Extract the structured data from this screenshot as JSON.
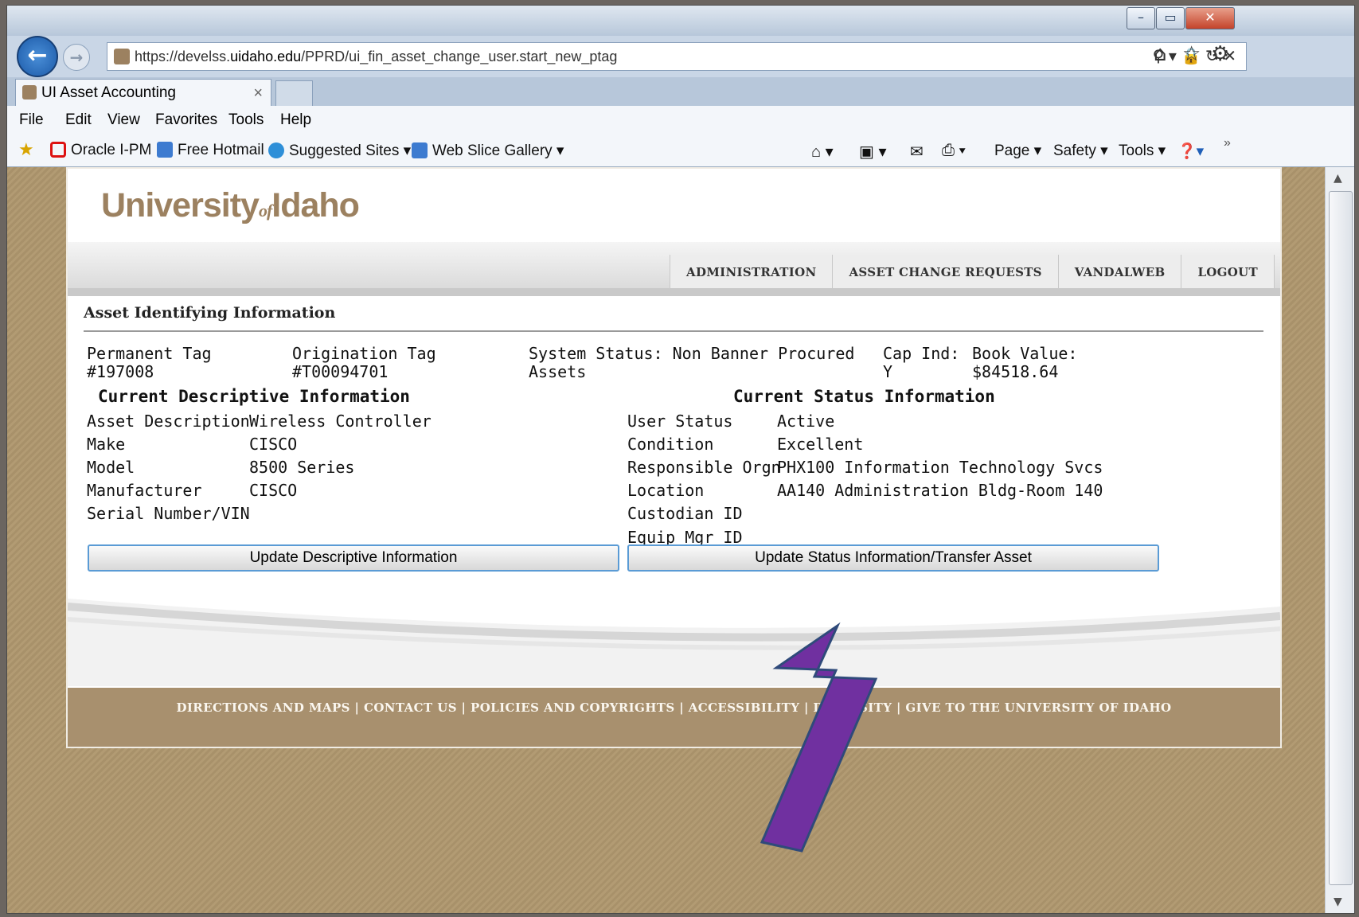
{
  "browser": {
    "url_scheme": "https://",
    "url_host_pre": "develss.",
    "url_host": "uidaho.edu",
    "url_path": "/PPRD/ui_fin_asset_change_user.start_new_ptag",
    "tab_title": "UI Asset Accounting",
    "tab_close": "×",
    "menu": [
      "File",
      "Edit",
      "View",
      "Favorites",
      "Tools",
      "Help"
    ],
    "favorites": [
      "Oracle I-PM",
      "Free Hotmail",
      "Suggested Sites ▾",
      "Web Slice Gallery ▾"
    ],
    "toolbar_right": [
      "Page ▾",
      "Safety ▾",
      "Tools ▾"
    ],
    "window_controls": [
      "–",
      "▭",
      "✕"
    ]
  },
  "site": {
    "logo_pre": "University",
    "logo_of": "of",
    "logo_post": "Idaho",
    "nav": [
      "ADMINISTRATION",
      "ASSET CHANGE REQUESTS",
      "VANDALWEB",
      "LOGOUT"
    ],
    "footer": "DIRECTIONS AND MAPS | CONTACT US | POLICIES AND COPYRIGHTS | ACCESSIBILITY | DIVERSITY | GIVE TO THE UNIVERSITY OF IDAHO"
  },
  "asset": {
    "section_title": "Asset Identifying Information",
    "perm_tag_label": "Permanent Tag",
    "perm_tag_value": "#197008",
    "orig_tag_label": "Origination Tag",
    "orig_tag_value": "#T00094701",
    "system_status_label": "System Status: Non Banner Procured",
    "system_status_value": "Assets",
    "cap_ind_label": "Cap Ind:",
    "cap_ind_value": "Y",
    "book_value_label": "Book Value:",
    "book_value_value": "$84518.64"
  },
  "descriptive": {
    "heading": "Current Descriptive Information",
    "rows": [
      {
        "label": "Asset Description",
        "value": "Wireless Controller"
      },
      {
        "label": "Make",
        "value": "CISCO"
      },
      {
        "label": "Model",
        "value": "8500 Series"
      },
      {
        "label": "Manufacturer",
        "value": "CISCO"
      },
      {
        "label": "Serial Number/VIN",
        "value": ""
      }
    ],
    "button": "Update Descriptive Information"
  },
  "status": {
    "heading": "Current Status Information",
    "rows": [
      {
        "label": "User Status",
        "value": "Active"
      },
      {
        "label": "Condition",
        "value": "Excellent"
      },
      {
        "label": "Responsible Orgn",
        "value": "PHX100 Information Technology Svcs"
      },
      {
        "label": "Location",
        "value": "AA140 Administration Bldg-Room 140"
      },
      {
        "label": "Custodian ID",
        "value": ""
      },
      {
        "label": "Equip Mgr ID",
        "value": ""
      }
    ],
    "button": "Update Status Information/Transfer Asset"
  },
  "colors": {
    "brand_gold": "#9c8160",
    "footer_bg": "#a8906e",
    "annotation_arrow": "#7030a0"
  }
}
